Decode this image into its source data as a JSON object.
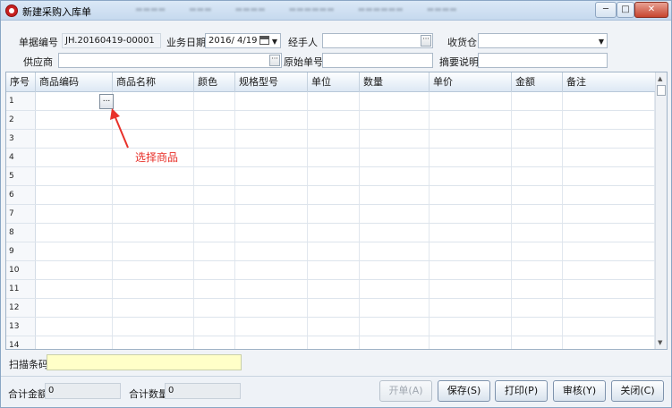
{
  "window": {
    "title": "新建采购入库单",
    "min_glyph": "─",
    "max_glyph": "□",
    "close_glyph": "✕"
  },
  "header": {
    "doc_no_label": "单据编号",
    "doc_no_value": "JH.20160419-00001",
    "biz_date_label": "业务日期",
    "biz_date_value": "2016/  4/19",
    "handler_label": "经手人",
    "handler_value": "",
    "warehouse_label": "收货仓",
    "warehouse_value": "",
    "supplier_label": "供应商",
    "supplier_value": "",
    "orig_no_label": "原始单号",
    "orig_no_value": "",
    "summary_label": "摘要说明",
    "summary_value": ""
  },
  "grid": {
    "columns": [
      "序号",
      "商品编码",
      "商品名称",
      "颜色",
      "规格型号",
      "单位",
      "数量",
      "单价",
      "金额",
      "备注"
    ],
    "rows": [
      "1",
      "2",
      "3",
      "4",
      "5",
      "6",
      "7",
      "8",
      "9",
      "10",
      "11",
      "12",
      "13",
      "14"
    ],
    "picker_glyph": "..."
  },
  "annotation": {
    "text": "选择商品",
    "color": "#e8312a"
  },
  "barcode": {
    "label": "扫描条码",
    "value": ""
  },
  "footer": {
    "total_amount_label": "合计金额",
    "total_amount_value": "0",
    "total_qty_label": "合计数量",
    "total_qty_value": "0",
    "open_button": "开单(A)",
    "save_button": "保存(S)",
    "print_button": "打印(P)",
    "audit_button": "审核(Y)",
    "close_button": "关闭(C)"
  },
  "colors": {
    "accent": "#c62020",
    "barcode_bg": "#ffffc8"
  }
}
